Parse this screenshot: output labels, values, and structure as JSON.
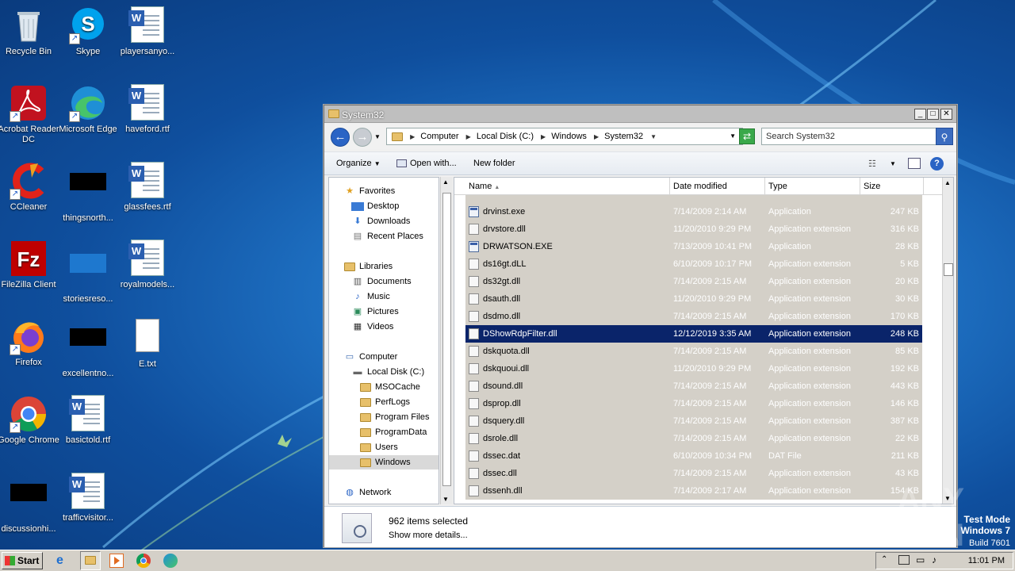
{
  "desktop": {
    "icons": [
      {
        "label": "Recycle Bin",
        "icon": "recycle-bin-icon"
      },
      {
        "label": "Skype",
        "icon": "skype-icon"
      },
      {
        "label": "playersanyo...",
        "icon": "word-document-icon"
      },
      {
        "label": "Acrobat Reader DC",
        "icon": "acrobat-icon"
      },
      {
        "label": "Microsoft Edge",
        "icon": "edge-icon"
      },
      {
        "label": "haveford.rtf",
        "icon": "word-document-icon"
      },
      {
        "label": "CCleaner",
        "icon": "ccleaner-icon"
      },
      {
        "label": "thingsnorth...",
        "icon": "redacted-icon"
      },
      {
        "label": "glassfees.rtf",
        "icon": "word-document-icon"
      },
      {
        "label": "FileZilla Client",
        "icon": "filezilla-icon"
      },
      {
        "label": "storiesreso...",
        "icon": "blank-icon"
      },
      {
        "label": "royalmodels...",
        "icon": "word-document-icon"
      },
      {
        "label": "Firefox",
        "icon": "firefox-icon"
      },
      {
        "label": "excellentno...",
        "icon": "redacted-icon"
      },
      {
        "label": "E.txt",
        "icon": "text-file-icon"
      },
      {
        "label": "Google Chrome",
        "icon": "chrome-icon"
      },
      {
        "label": "basictold.rtf",
        "icon": "word-document-icon"
      },
      {
        "label": "discussionhi...",
        "icon": "redacted-icon"
      },
      {
        "label": "trafficvisitor...",
        "icon": "word-document-icon"
      }
    ]
  },
  "window": {
    "title": "System32",
    "breadcrumbs": [
      "Computer",
      "Local Disk (C:)",
      "Windows",
      "System32"
    ],
    "search_placeholder": "Search System32",
    "toolbar": {
      "organize": "Organize",
      "open_with": "Open with...",
      "new_folder": "New folder"
    },
    "nav": {
      "favorites": "Favorites",
      "desktop": "Desktop",
      "downloads": "Downloads",
      "recent": "Recent Places",
      "libraries": "Libraries",
      "documents": "Documents",
      "music": "Music",
      "pictures": "Pictures",
      "videos": "Videos",
      "computer": "Computer",
      "local_disk": "Local Disk (C:)",
      "msocache": "MSOCache",
      "perflogs": "PerfLogs",
      "program_files": "Program Files",
      "programdata": "ProgramData",
      "users": "Users",
      "windows": "Windows",
      "network": "Network"
    },
    "columns": {
      "name": "Name",
      "date": "Date modified",
      "type": "Type",
      "size": "Size"
    },
    "files": [
      {
        "name": "drvinst.exe",
        "date": "7/14/2009 2:14 AM",
        "type": "Application",
        "size": "247 KB",
        "kind": "exe"
      },
      {
        "name": "drvstore.dll",
        "date": "11/20/2010 9:29 PM",
        "type": "Application extension",
        "size": "316 KB",
        "kind": "dll"
      },
      {
        "name": "DRWATSON.EXE",
        "date": "7/13/2009 10:41 PM",
        "type": "Application",
        "size": "28 KB",
        "kind": "exe"
      },
      {
        "name": "ds16gt.dLL",
        "date": "6/10/2009 10:17 PM",
        "type": "Application extension",
        "size": "5 KB",
        "kind": "dll"
      },
      {
        "name": "ds32gt.dll",
        "date": "7/14/2009 2:15 AM",
        "type": "Application extension",
        "size": "20 KB",
        "kind": "dll"
      },
      {
        "name": "dsauth.dll",
        "date": "11/20/2010 9:29 PM",
        "type": "Application extension",
        "size": "30 KB",
        "kind": "dll"
      },
      {
        "name": "dsdmo.dll",
        "date": "7/14/2009 2:15 AM",
        "type": "Application extension",
        "size": "170 KB",
        "kind": "dll"
      },
      {
        "name": "DShowRdpFilter.dll",
        "date": "12/12/2019 3:35 AM",
        "type": "Application extension",
        "size": "248 KB",
        "kind": "dll",
        "selected": true
      },
      {
        "name": "dskquota.dll",
        "date": "7/14/2009 2:15 AM",
        "type": "Application extension",
        "size": "85 KB",
        "kind": "dll"
      },
      {
        "name": "dskquoui.dll",
        "date": "11/20/2010 9:29 PM",
        "type": "Application extension",
        "size": "192 KB",
        "kind": "dll"
      },
      {
        "name": "dsound.dll",
        "date": "7/14/2009 2:15 AM",
        "type": "Application extension",
        "size": "443 KB",
        "kind": "dll"
      },
      {
        "name": "dsprop.dll",
        "date": "7/14/2009 2:15 AM",
        "type": "Application extension",
        "size": "146 KB",
        "kind": "dll"
      },
      {
        "name": "dsquery.dll",
        "date": "7/14/2009 2:15 AM",
        "type": "Application extension",
        "size": "387 KB",
        "kind": "dll"
      },
      {
        "name": "dsrole.dll",
        "date": "7/14/2009 2:15 AM",
        "type": "Application extension",
        "size": "22 KB",
        "kind": "dll"
      },
      {
        "name": "dssec.dat",
        "date": "6/10/2009 10:34 PM",
        "type": "DAT File",
        "size": "211 KB",
        "kind": "dat"
      },
      {
        "name": "dssec.dll",
        "date": "7/14/2009 2:15 AM",
        "type": "Application extension",
        "size": "43 KB",
        "kind": "dll"
      },
      {
        "name": "dssenh.dll",
        "date": "7/14/2009 2:17 AM",
        "type": "Application extension",
        "size": "154 KB",
        "kind": "dll"
      }
    ],
    "status": {
      "count": "962 items selected",
      "details": "Show more details..."
    }
  },
  "taskbar": {
    "start": "Start",
    "clock": "11:01 PM"
  },
  "watermark": {
    "mode": "Test Mode",
    "os": "Windows 7",
    "build": "Build 7601",
    "brand": "ANY RUN"
  }
}
